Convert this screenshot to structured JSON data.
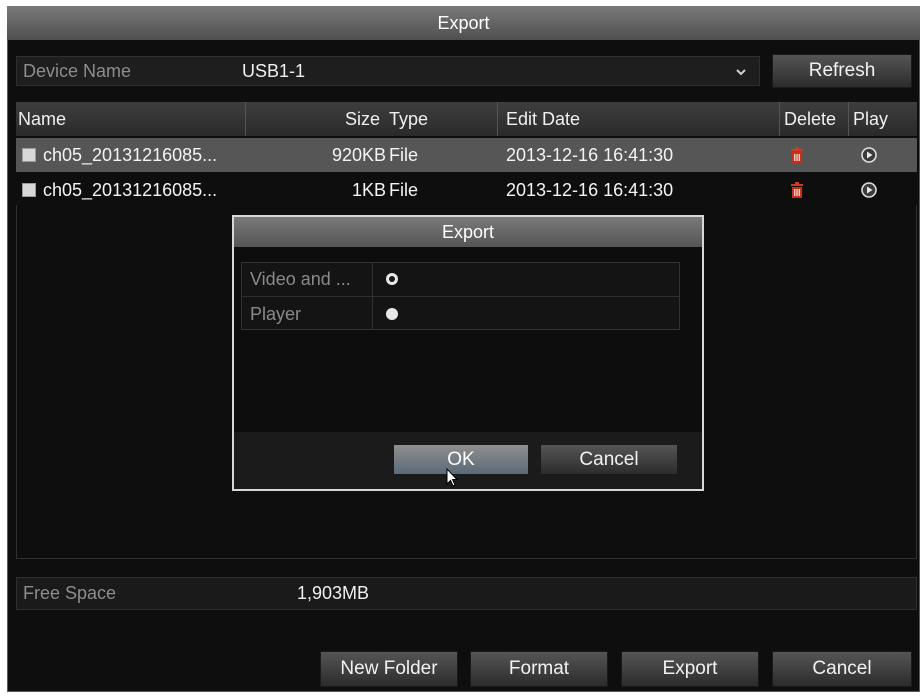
{
  "window": {
    "title": "Export"
  },
  "device": {
    "label": "Device Name",
    "value": "USB1-1",
    "refresh_label": "Refresh"
  },
  "table": {
    "headers": {
      "name": "Name",
      "size": "Size",
      "type": "Type",
      "edit_date": "Edit Date",
      "delete": "Delete",
      "play": "Play"
    },
    "rows": [
      {
        "name": "ch05_20131216085...",
        "size": "920KB",
        "type": "File",
        "edit_date": "2013-12-16 16:41:30"
      },
      {
        "name": "ch05_20131216085...",
        "size": "1KB",
        "type": "File",
        "edit_date": "2013-12-16 16:41:30"
      }
    ]
  },
  "free_space": {
    "label": "Free Space",
    "value": "1,903MB"
  },
  "footer": {
    "new_folder": "New Folder",
    "format": "Format",
    "export": "Export",
    "cancel": "Cancel"
  },
  "dialog": {
    "title": "Export",
    "options": [
      {
        "label": "Video and ...",
        "selected": true
      },
      {
        "label": "Player",
        "selected": false
      }
    ],
    "ok_label": "OK",
    "cancel_label": "Cancel"
  },
  "colors": {
    "accent_selected_row": "#565656",
    "delete_icon": "#c83018",
    "title_bar": "#6a6a6a"
  }
}
